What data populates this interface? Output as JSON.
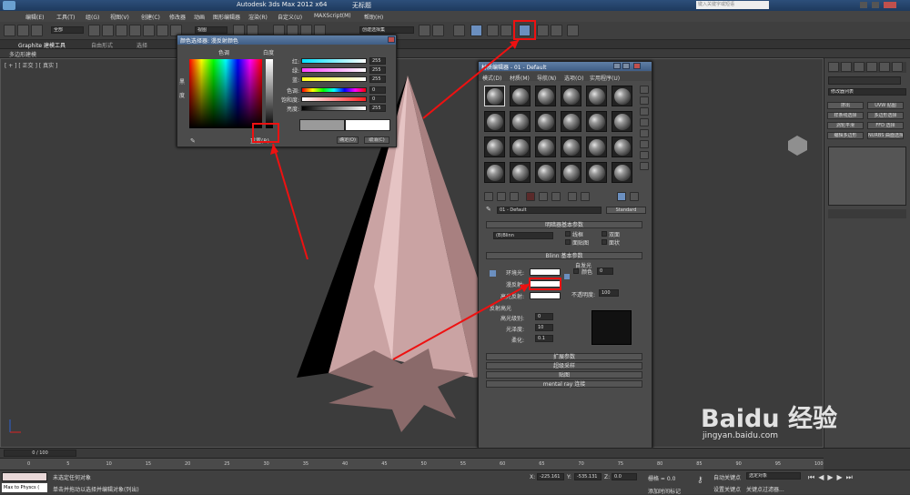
{
  "app": {
    "title_left": "Autodesk 3ds Max  2012 x64",
    "title_right": "无标题",
    "search_placeholder": "键入关键字或短语"
  },
  "menu": [
    "编辑(E)",
    "工具(T)",
    "组(G)",
    "视图(V)",
    "创建(C)",
    "修改器",
    "动画",
    "图形编辑器",
    "渲染(R)",
    "自定义(U)",
    "MAXScript(M)",
    "帮助(H)"
  ],
  "toolbar": {
    "filter_value": "全部",
    "view_value": "视图",
    "selection_set": "创建选择集"
  },
  "ribbon": {
    "tab1": "Graphite 建模工具",
    "tab2": "自由形式",
    "tab3": "选择"
  },
  "ribbon_sub": "多边形建模",
  "viewport": {
    "label": "[ + ] [ 正交 ] [ 真实 ]"
  },
  "color_dialog": {
    "title": "颜色选择器: 漫反射颜色",
    "hue_label": "色调",
    "white_label": "白度",
    "black_label": "黑",
    "degree_label": "度",
    "channels": [
      {
        "label": "红:",
        "value": "255",
        "color": "#00d8ff"
      },
      {
        "label": "绿:",
        "value": "255",
        "color": "#ff60ff"
      },
      {
        "label": "蓝:",
        "value": "255",
        "color": "#ffff40"
      },
      {
        "label": "色调:",
        "value": "0",
        "color": "#ff4040"
      },
      {
        "label": "饱和度:",
        "value": "0",
        "color": "#ff6060"
      },
      {
        "label": "亮度:",
        "value": "255",
        "color": "#dddddd"
      }
    ],
    "reset_label": "重置(R)",
    "ok_label": "确定(O)",
    "cancel_label": "取消(C)"
  },
  "material_editor": {
    "title": "材质编辑器 - 01 - Default",
    "menu": [
      "模式(D)",
      "材质(M)",
      "导航(N)",
      "选项(O)",
      "实用程序(U)"
    ],
    "material_name": "01 - Default",
    "material_type": "Standard",
    "shader_rollout": "明暗器基本参数",
    "shader_value": "(B)Blinn",
    "checks": [
      "线框",
      "双面",
      "面贴图",
      "面状"
    ],
    "blinn_rollout": "Blinn 基本参数",
    "self_illum": "自发光",
    "color_label": "颜色",
    "color_value": "0",
    "ambient_label": "环境光:",
    "diffuse_label": "漫反射:",
    "specular_label": "高光反射:",
    "opacity_label": "不透明度:",
    "opacity_value": "100",
    "spec_highlights": "反射高光",
    "spec_level_label": "高光级别:",
    "spec_level_value": "0",
    "gloss_label": "光泽度:",
    "gloss_value": "10",
    "soften_label": "柔化:",
    "soften_value": "0.1",
    "rollouts": [
      "扩展参数",
      "超级采样",
      "贴图",
      "mental ray 连接"
    ]
  },
  "command_panel": {
    "modifier_list": "修改器列表",
    "buttons": [
      "挤出",
      "UVW 贴图",
      "样条线选择",
      "多边形选择",
      "涡轮平滑",
      "FFD 选择",
      "编辑多边形",
      "NURBS 曲面选择"
    ]
  },
  "timeline": {
    "frame": "0 / 100",
    "ticks": [
      "0",
      "5",
      "10",
      "15",
      "20",
      "25",
      "30",
      "35",
      "40",
      "45",
      "50",
      "55",
      "60",
      "65",
      "70",
      "75",
      "80",
      "85",
      "90",
      "95",
      "100"
    ]
  },
  "status": {
    "line1": "未选定任何对象",
    "line2": "单击并拖动以选择并编辑对象(列出)",
    "script_box": "Max to Physcs (",
    "x_label": "X:",
    "x_value": "-225.161",
    "y_label": "Y:",
    "y_value": "-535.131",
    "z_label": "Z:",
    "z_value": "0.0",
    "grid": "栅格 = 0.0",
    "auto_key": "自动关键点",
    "set_key": "设置关键点",
    "selected_obj": "选定对象",
    "key_filters": "关键点过滤器...",
    "add_time_tag": "添加时间标记"
  },
  "watermark": {
    "brand": "Baidu 经验",
    "url": "jingyan.baidu.com"
  }
}
